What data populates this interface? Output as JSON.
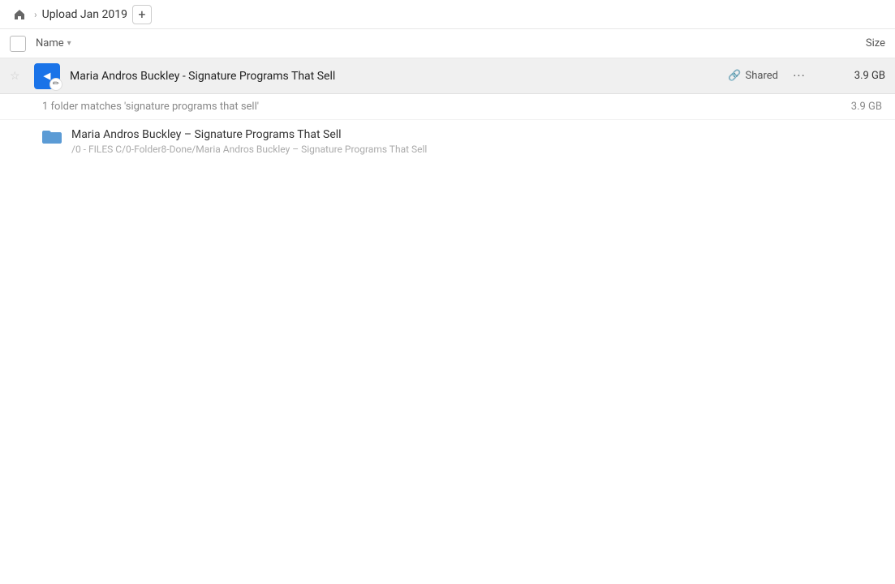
{
  "breadcrumb": {
    "home_label": "Home",
    "title": "Upload Jan 2019",
    "add_button_label": "+"
  },
  "columns": {
    "name_label": "Name",
    "size_label": "Size"
  },
  "file_item": {
    "name": "Maria Andros Buckley - Signature Programs That Sell",
    "shared_label": "Shared",
    "size": "3.9 GB",
    "more_label": "···"
  },
  "matches_bar": {
    "text": "1 folder matches 'signature programs that sell'",
    "size": "3.9 GB"
  },
  "subfolder": {
    "name": "Maria Andros Buckley – Signature Programs That Sell",
    "path": "/0 - FILES C/0-Folder8-Done/Maria Andros Buckley – Signature Programs That Sell"
  }
}
